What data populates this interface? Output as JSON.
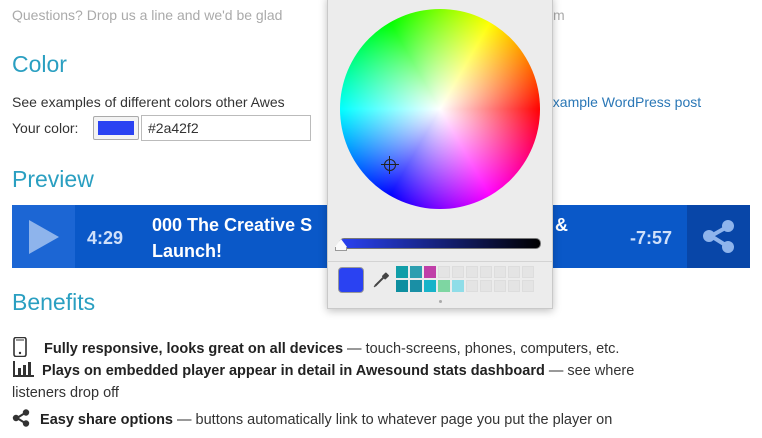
{
  "intro": {
    "text": "Questions? Drop us a line and we'd be glad",
    "text_tail": "m"
  },
  "color_section": {
    "heading": "Color",
    "description": "See examples of different colors other Awes",
    "example_link": "example WordPress post",
    "your_color_label": "Your color:",
    "hex_value": "#2a42f2",
    "swatch_color": "#2a42f2"
  },
  "preview_section": {
    "heading": "Preview",
    "player": {
      "elapsed": "4:29",
      "title_line1_start": "000 The Creative S",
      "title_line1_end": "&",
      "title_line2": "Launch!",
      "remaining": "-7:57",
      "bg_color": "#0a58c8"
    }
  },
  "benefits_section": {
    "heading": "Benefits",
    "items": [
      {
        "icon": "mobile-phone-icon",
        "bold": "Fully responsive, looks great on all devices",
        "rest": " — touch-screens, phones, computers, etc."
      },
      {
        "icon": "bar-chart-icon",
        "bold": "Plays on embedded player appear in detail in Awesound stats dashboard",
        "rest": " — see where",
        "rest_line2": "listeners drop off"
      },
      {
        "icon": "share-icon",
        "bold": "Easy share options",
        "rest": " — buttons automatically link to whatever page you put the player on"
      }
    ]
  },
  "color_picker": {
    "selected_color": "#2a42f2",
    "swatches_row1": [
      "#119ea8",
      "#2e9fb0",
      "#c03fa8",
      "",
      "",
      "",
      "",
      "",
      "",
      ""
    ],
    "swatches_row2": [
      "#0e8fa0",
      "#1a8fa5",
      "#17b3c9",
      "#7ed6a2",
      "#8fdde8",
      "",
      "",
      "",
      "",
      ""
    ]
  }
}
